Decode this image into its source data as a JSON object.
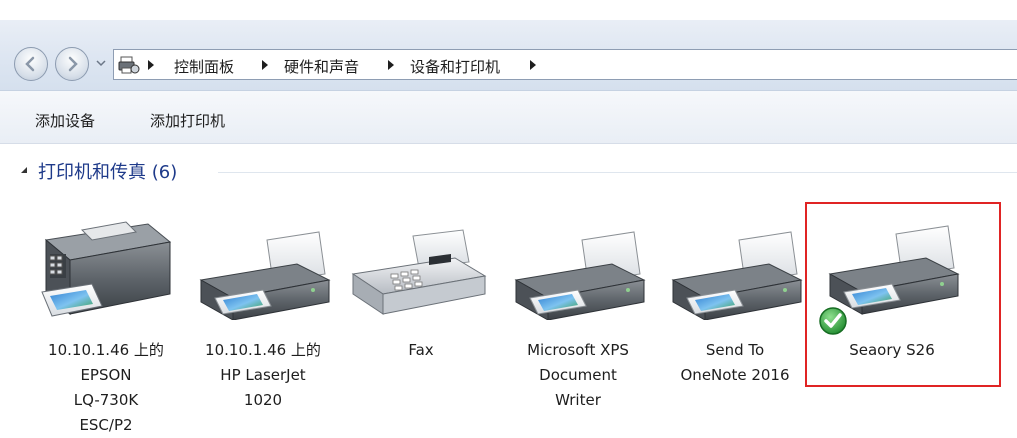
{
  "breadcrumb": [
    "控制面板",
    "硬件和声音",
    "设备和打印机"
  ],
  "toolbar": {
    "add_device": "添加设备",
    "add_printer": "添加打印机"
  },
  "group": {
    "title": "打印机和传真 (6)"
  },
  "devices": [
    {
      "label": "10.10.1.46 上的\nEPSON\nLQ-730K\nESC/P2",
      "icon": "dot-matrix-printer-icon"
    },
    {
      "label": "10.10.1.46 上的\nHP LaserJet\n1020",
      "icon": "printer-icon"
    },
    {
      "label": "Fax",
      "icon": "fax-icon"
    },
    {
      "label": "Microsoft XPS\nDocument\nWriter",
      "icon": "printer-icon"
    },
    {
      "label": "Send To\nOneNote 2016",
      "icon": "printer-icon"
    },
    {
      "label": "Seaory S26",
      "icon": "printer-icon",
      "default": true,
      "selected": true
    }
  ],
  "colors": {
    "selection_border": "#e02424",
    "group_title": "#1e3a8a",
    "default_check": "#2e9e3a"
  }
}
